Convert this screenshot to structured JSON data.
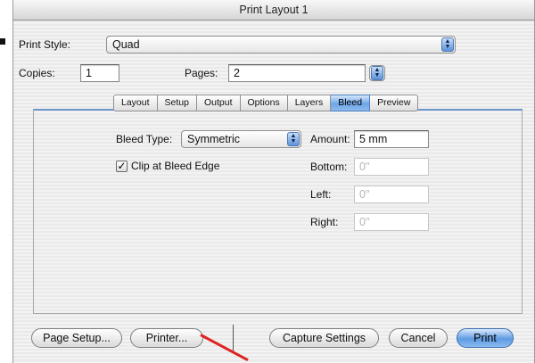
{
  "window": {
    "title": "Print Layout 1"
  },
  "print_style": {
    "label": "Print Style:",
    "value": "Quad"
  },
  "copies": {
    "label": "Copies:",
    "value": "1"
  },
  "pages": {
    "label": "Pages:",
    "value": "2"
  },
  "tabs": [
    {
      "label": "Layout"
    },
    {
      "label": "Setup"
    },
    {
      "label": "Output"
    },
    {
      "label": "Options"
    },
    {
      "label": "Layers"
    },
    {
      "label": "Bleed",
      "active": true
    },
    {
      "label": "Preview"
    }
  ],
  "bleed": {
    "type_label": "Bleed Type:",
    "type_value": "Symmetric",
    "clip_label": "Clip at Bleed Edge",
    "clip_checked": true,
    "amount_label": "Amount:",
    "amount_value": "5 mm",
    "bottom_label": "Bottom:",
    "bottom_value": "0\"",
    "left_label": "Left:",
    "left_value": "0\"",
    "right_label": "Right:",
    "right_value": "0\""
  },
  "buttons": {
    "page_setup": "Page Setup...",
    "printer": "Printer...",
    "capture_settings": "Capture Settings",
    "cancel": "Cancel",
    "print": "Print"
  },
  "colors": {
    "accent_blue": "#6ea6e6",
    "annotation_arrow": "#e02222"
  }
}
